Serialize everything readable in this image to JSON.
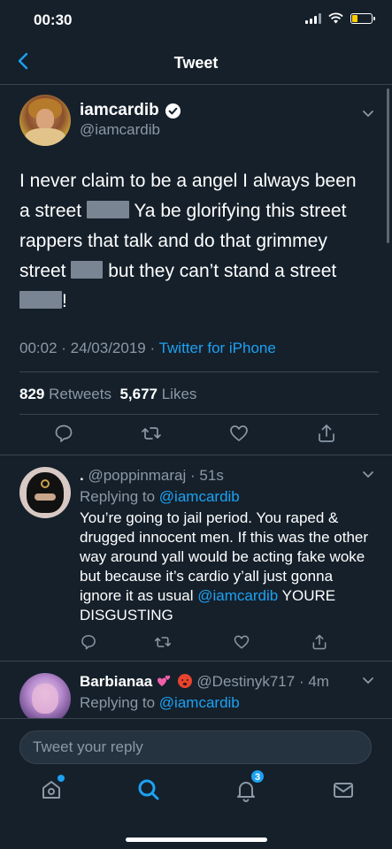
{
  "status_bar": {
    "time": "00:30"
  },
  "nav": {
    "title": "Tweet"
  },
  "main_tweet": {
    "display_name": "iamcardib",
    "handle": "@iamcardib",
    "text": {
      "line1": "I never claim to be a angel I always been",
      "line2a": "a street",
      "line2b": "Ya be glorifying this street",
      "line3": "rappers that talk and do that grimmey",
      "line4a": "street",
      "line4b": "but they can’t stand a street",
      "line5": "!"
    },
    "time": "00:02",
    "sep1": " · ",
    "date": "24/03/2019",
    "sep2": " · ",
    "source": "Twitter for iPhone",
    "retweets": "829",
    "retweets_label": "Retweets",
    "likes": "5,677",
    "likes_label": "Likes"
  },
  "replies": [
    {
      "display_name": ".",
      "handle": "@poppinmaraj",
      "sep": " · ",
      "time": "51s",
      "replying_label": "Replying to",
      "replying_to": "@iamcardib",
      "text_main": "You’re going to jail period. You raped & drugged innocent men. If this was the other way around yall would be acting fake woke but because it’s cardio y’all just gonna ignore it as usual",
      "text_mention": "@iamcardib",
      "text_tail": "YOURE DISGUSTING"
    },
    {
      "display_name": "Barbianaa",
      "handle": "@Destinyk717",
      "sep": " · ",
      "time": "4m",
      "replying_label": "Replying to",
      "replying_to": "@iamcardib"
    }
  ],
  "compose": {
    "placeholder": "Tweet your reply"
  },
  "tabbar": {
    "notifications_badge": "3"
  },
  "colors": {
    "background": "#15202b",
    "accent": "#1da1f2",
    "muted": "#8b98a5",
    "divider": "#38444d"
  }
}
